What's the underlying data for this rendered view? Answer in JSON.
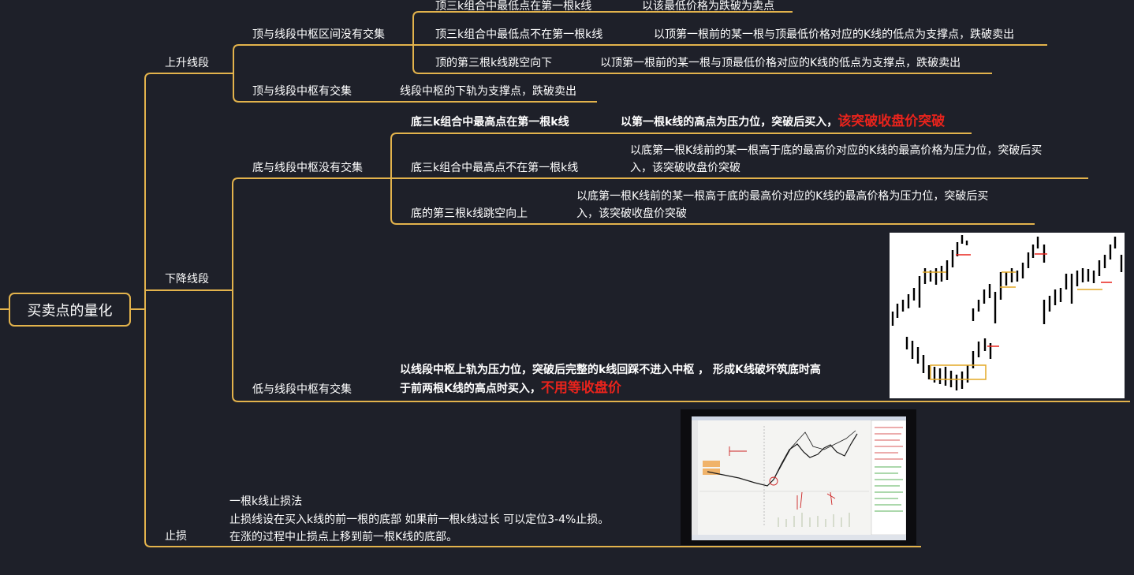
{
  "root": "买卖点的量化",
  "up": {
    "label": "上升线段",
    "no_overlap": {
      "label": "顶与线段中枢区间没有交集",
      "items": [
        {
          "cond": "顶三k组合中最低点在第一根k线",
          "action": "以该最低价格为跌破为卖点"
        },
        {
          "cond": "顶三k组合中最低点不在第一根k线",
          "action": "以顶第一根前的某一根与顶最低价格对应的K线的低点为支撑点，跌破卖出"
        },
        {
          "cond": "顶的第三根k线跳空向下",
          "action": "以顶第一根前的某一根与顶最低价格对应的K线的低点为支撑点，跌破卖出"
        }
      ]
    },
    "overlap": {
      "label": "顶与线段中枢有交集",
      "action": "线段中枢的下轨为支撑点，跌破卖出"
    }
  },
  "down": {
    "label": "下降线段",
    "no_overlap": {
      "label": "底与线段中枢没有交集",
      "items": [
        {
          "cond": "底三k组合中最高点在第一根k线",
          "action": "以第一根k线的高点为压力位，突破后买入，",
          "emph": "该突破收盘价突破"
        },
        {
          "cond": "底三k组合中最高点不在第一根k线",
          "action1": "以底第一根K线前的某一根高于底的最高价对应的K线的最高价格为压力位，突破后买",
          "action2": "入，该突破收盘价突破"
        },
        {
          "cond": "底的第三根k线跳空向上",
          "action1": "以底第一根K线前的某一根高于底的最高价对应的K线的最高价格为压力位，突破后买",
          "action2": "入，该突破收盘价突破"
        }
      ]
    },
    "overlap": {
      "label": "低与线段中枢有交集",
      "action1": "以线段中枢上轨为压力位，突破后完整的k线回踩不进入中枢 ， 形成K线破坏筑底时高",
      "action2": "于前两根K线的高点时买入，",
      "emph": "不用等收盘价"
    }
  },
  "stop": {
    "label": "止损",
    "lines": [
      "一根k线止损法",
      "止损线设在买入k线的前一根的底部  如果前一根k线过长  可以定位3-4%止损。",
      "在涨的过程中止损点上移到前一根K线的底部。"
    ]
  },
  "colors": {
    "background": "#1e2029",
    "branch": "#e3b34c",
    "emphasis": "#e8231c",
    "text": "#ffffff"
  }
}
